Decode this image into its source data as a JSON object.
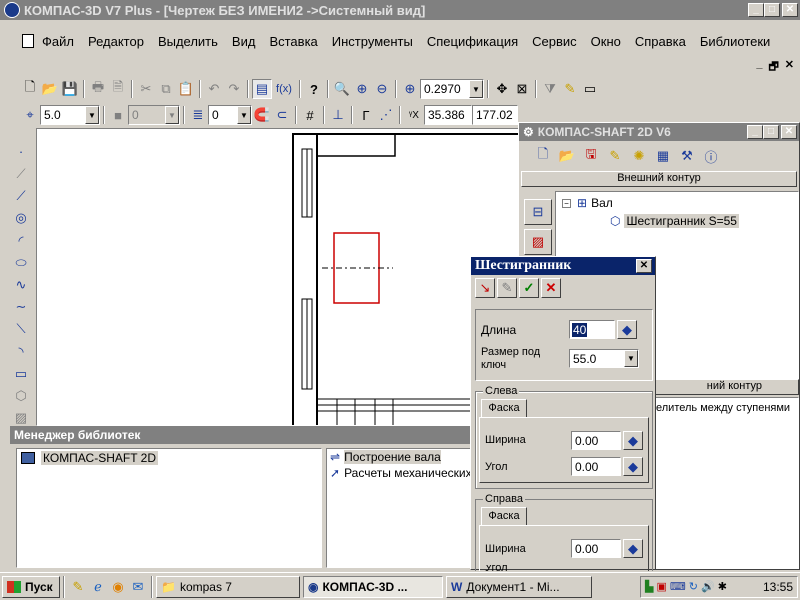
{
  "window": {
    "title": "КОМПАС-3D V7 Plus - [Чертеж БЕЗ ИМЕНИ2 ->Системный вид]"
  },
  "menu": [
    "Файл",
    "Редактор",
    "Выделить",
    "Вид",
    "Вставка",
    "Инструменты",
    "Спецификация",
    "Сервис",
    "Окно",
    "Справка",
    "Библиотеки"
  ],
  "toolbar": {
    "zoom": "0.2970",
    "fx": "f(x)"
  },
  "props": {
    "step": "5.0",
    "layer": "0",
    "style": "0",
    "coord_x": "35.386",
    "coord_y": "177.02"
  },
  "library_manager": {
    "title": "Менеджер библиотек",
    "items": [
      "КОМПАС-SHAFT 2D"
    ],
    "right_items": [
      "Построение вала",
      "Расчеты механических"
    ]
  },
  "shaft": {
    "title": "КОМПАС-SHAFT 2D V6",
    "section_external": "Внешний контур",
    "tree_root": "Вал",
    "tree_child": "Шестигранник S=55",
    "section_internal": "ний контур",
    "note": "елитель между ступенями"
  },
  "hex": {
    "title": "Шестигранник",
    "length_label": "Длина",
    "length_value": "40",
    "size_label_1": "Размер под",
    "size_label_2": "ключ",
    "size_value": "55.0",
    "left": {
      "group": "Слева",
      "tab": "Фаска",
      "width_label": "Ширина",
      "width_value": "0.00",
      "angle_label": "Угол",
      "angle_value": "0.00"
    },
    "right": {
      "group": "Справа",
      "tab": "Фаска",
      "width_label": "Ширина",
      "width_value": "0.00",
      "angle_label": "Угол"
    }
  },
  "taskbar": {
    "start": "Пуск",
    "tasks": [
      "kompas 7",
      "КОМПАС-3D ...",
      "Документ1 - Mi..."
    ],
    "clock": "13:55"
  },
  "colors": {
    "title_active": "#0a246a",
    "title_inactive": "#808080",
    "selection": "#0a246a",
    "drawing_red": "#cc0000"
  }
}
